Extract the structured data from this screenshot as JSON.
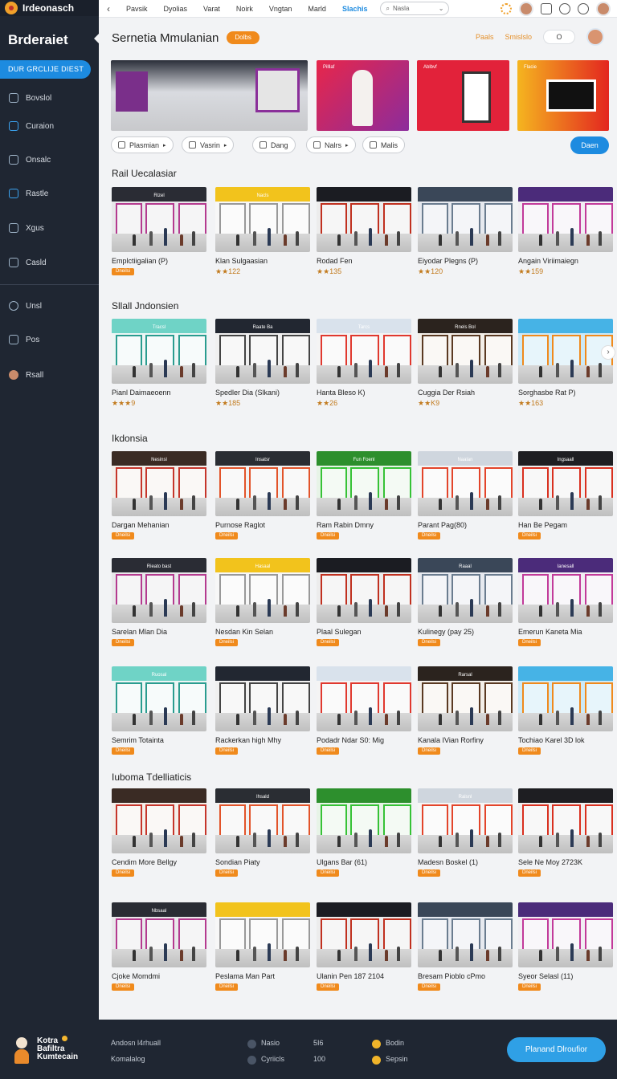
{
  "app": {
    "name": "Irdeonasch"
  },
  "colors": {
    "accent": "#1d8be0",
    "orange": "#f08a1c",
    "sidebar": "#1f2632"
  },
  "sidebar": {
    "title": "Brderaiet",
    "cta": "DUR GRCLIJE DIEST",
    "items": [
      {
        "label": "Bovslol",
        "icon": "document-icon"
      },
      {
        "label": "Curaion",
        "icon": "list-icon"
      },
      {
        "label": "Onsalc",
        "icon": "clipboard-icon"
      },
      {
        "label": "Rastle",
        "icon": "pen-icon"
      },
      {
        "label": "Xgus",
        "icon": "bag-icon"
      },
      {
        "label": "Casld",
        "icon": "tools-icon"
      },
      {
        "label": "Unsl",
        "icon": "clock-icon"
      },
      {
        "label": "Pos",
        "icon": "edit-icon"
      },
      {
        "label": "Rsall",
        "icon": "user-icon"
      }
    ]
  },
  "topbar": {
    "nav": [
      "Pavsik",
      "Dyolias",
      "Varat",
      "Noirk",
      "Vngtan",
      "Marld",
      "Slachis"
    ],
    "search_placeholder": "Nasla"
  },
  "header": {
    "title": "Sernetia Mmulanian",
    "badge": "Dolbs",
    "links": [
      "Paals",
      "Smislslo"
    ],
    "toggle": "O"
  },
  "banners": [
    {
      "label": ""
    },
    {
      "label": "Pilllaf"
    },
    {
      "label": "Ablbvf"
    },
    {
      "label": "Flacie"
    }
  ],
  "filters": {
    "chips": [
      "Plasmian",
      "Vasrin",
      "Dang",
      "Nalrs",
      "Malis"
    ],
    "cta": "Daen"
  },
  "sections": [
    {
      "title": "Rail Uecalasiar",
      "cards": [
        {
          "name": "Emplctiigalian (P)",
          "tag": "Dneilsi",
          "sign": "Rizel"
        },
        {
          "name": "Klan Sulgaasian",
          "rating": "★★122",
          "sign": "Nacls"
        },
        {
          "name": "Rodad Fen",
          "rating": "★★135",
          "sign": ""
        },
        {
          "name": "Eiyodar Plegns (P)",
          "rating": "★★120",
          "sign": ""
        },
        {
          "name": "Angain Viriimaiegn",
          "rating": "★★159",
          "sign": ""
        }
      ]
    },
    {
      "title": "Sllall Jndonsien",
      "cards": [
        {
          "name": "Pianl Daimaeoenn",
          "rating": "★★★9",
          "sign": "Tracsl"
        },
        {
          "name": "Spedler Dia (Slkani)",
          "rating": "★★185",
          "sign": "Raate Ba"
        },
        {
          "name": "Hanta Bleso K)",
          "rating": "★★26",
          "sign": "Tarcs"
        },
        {
          "name": "Cuggia Der Rsiah",
          "rating": "★★K9",
          "sign": "Rnels Bol"
        },
        {
          "name": "Sorghasbe Rat P)",
          "rating": "★★163",
          "sign": ""
        }
      ]
    },
    {
      "title": "Ikdonsia",
      "cards": [
        {
          "name": "Dargan Mehanian",
          "tag": "Dneilsi",
          "sign": "Nesinsl"
        },
        {
          "name": "Purnose Raglot",
          "tag": "Dneilsi",
          "sign": "Insatsr"
        },
        {
          "name": "Ram Rabin Dmny",
          "tag": "Dneilsi",
          "sign": "Fun Foenl"
        },
        {
          "name": "Parant Pag(80)",
          "tag": "Dneilsi",
          "sign": "Naalan"
        },
        {
          "name": "Han Be Pegam",
          "tag": "Dneilsi",
          "sign": "Ingsaall"
        }
      ]
    },
    {
      "title": "",
      "cards": [
        {
          "name": "Sarelan Mlan Dia",
          "tag": "Dneilsi",
          "sign": "Rieato bast"
        },
        {
          "name": "Nesdan Kin Selan",
          "tag": "Dneilsi",
          "sign": "Hasaal"
        },
        {
          "name": "Plaal Sulegan",
          "tag": "Dneilsi",
          "sign": ""
        },
        {
          "name": "Kulinegy (pay 25)",
          "tag": "Dneilsi",
          "sign": "Raaal"
        },
        {
          "name": "Emerun Kaneta Mia",
          "tag": "Dneilsi",
          "sign": "Ianesall"
        }
      ]
    },
    {
      "title": "",
      "cards": [
        {
          "name": "Semrim Totainta",
          "tag": "Dneilsi",
          "sign": "Ruosal"
        },
        {
          "name": "Rackerkan high Mhy",
          "tag": "Dneilsi",
          "sign": ""
        },
        {
          "name": "Podadr Ndar S0: Mig",
          "tag": "Dneilsi",
          "sign": ""
        },
        {
          "name": "Kanala IVian Rorfiny",
          "tag": "Dneilsi",
          "sign": "Rarsal"
        },
        {
          "name": "Tochiao Karel 3D lok",
          "tag": "Dneilsi",
          "sign": ""
        }
      ]
    },
    {
      "title": "Iuboma Tdelliaticis",
      "cards": [
        {
          "name": "Cendim More Bellgy",
          "tag": "Dneilsi",
          "sign": ""
        },
        {
          "name": "Sondian Piaty",
          "tag": "Dneilsi",
          "sign": "Ihsald"
        },
        {
          "name": "Ulgans Bar (61)",
          "tag": "Dneilsi",
          "sign": ""
        },
        {
          "name": "Madesn Boskel (1)",
          "tag": "Dneilsi",
          "sign": "Ralsnl"
        },
        {
          "name": "Sele Ne Moy 2723K",
          "tag": "Dneilsi",
          "sign": ""
        }
      ]
    },
    {
      "title": "",
      "cards": [
        {
          "name": "Cjoke Momdmi",
          "tag": "Dneilsi",
          "sign": "Nbsaal"
        },
        {
          "name": "Peslama Man Part",
          "tag": "Dneilsi",
          "sign": ""
        },
        {
          "name": "Ulanin Pen 187 2104",
          "tag": "Dneilsi",
          "sign": ""
        },
        {
          "name": "Bresam Pioblo cPmo",
          "tag": "Dneilsi",
          "sign": ""
        },
        {
          "name": "Syeor Selasl (11)",
          "tag": "Dneilsi",
          "sign": ""
        }
      ]
    }
  ],
  "footer": {
    "brand": "Kotra Bafiltra Kumtecain",
    "col1": [
      "Andosn l4rhuall",
      "Komalalog"
    ],
    "col2": [
      "Nasio",
      "Cyriicls"
    ],
    "col3": [
      "5I6",
      "100"
    ],
    "col4": [
      "Bodin",
      "Sepsin"
    ],
    "cta": "Planand Dlroufior"
  }
}
